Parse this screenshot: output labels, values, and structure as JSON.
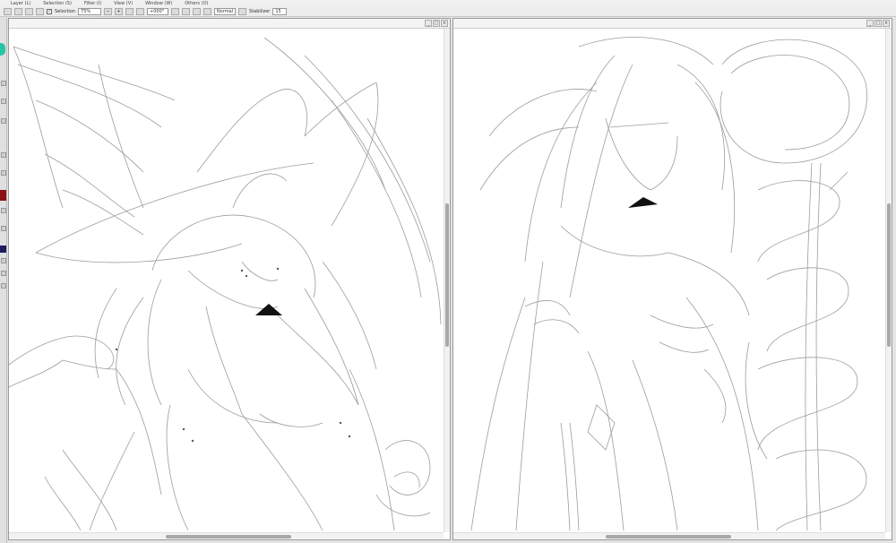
{
  "menu": [
    "Layer (L)",
    "Selection (S)",
    "Filter (I)",
    "View (V)",
    "Window (W)",
    "Others (O)"
  ],
  "toolbar": {
    "selection_label": "Selection",
    "zoom_value": "75%",
    "rotation_value": "+000°",
    "blend_mode": "Normal",
    "stabilizer_label": "Stabilizer",
    "stabilizer_value": "15"
  },
  "canvas_left": {
    "title": "",
    "scroll_v_fraction": 0.55,
    "scroll_h_fraction": 0.35
  },
  "canvas_right": {
    "title": "",
    "scroll_v_fraction": 0.55,
    "scroll_h_fraction": 0.5
  },
  "colors": {
    "accent_teal": "#27c3a6",
    "swatch_red": "#8b1212",
    "swatch_navy": "#1d1d5c"
  }
}
